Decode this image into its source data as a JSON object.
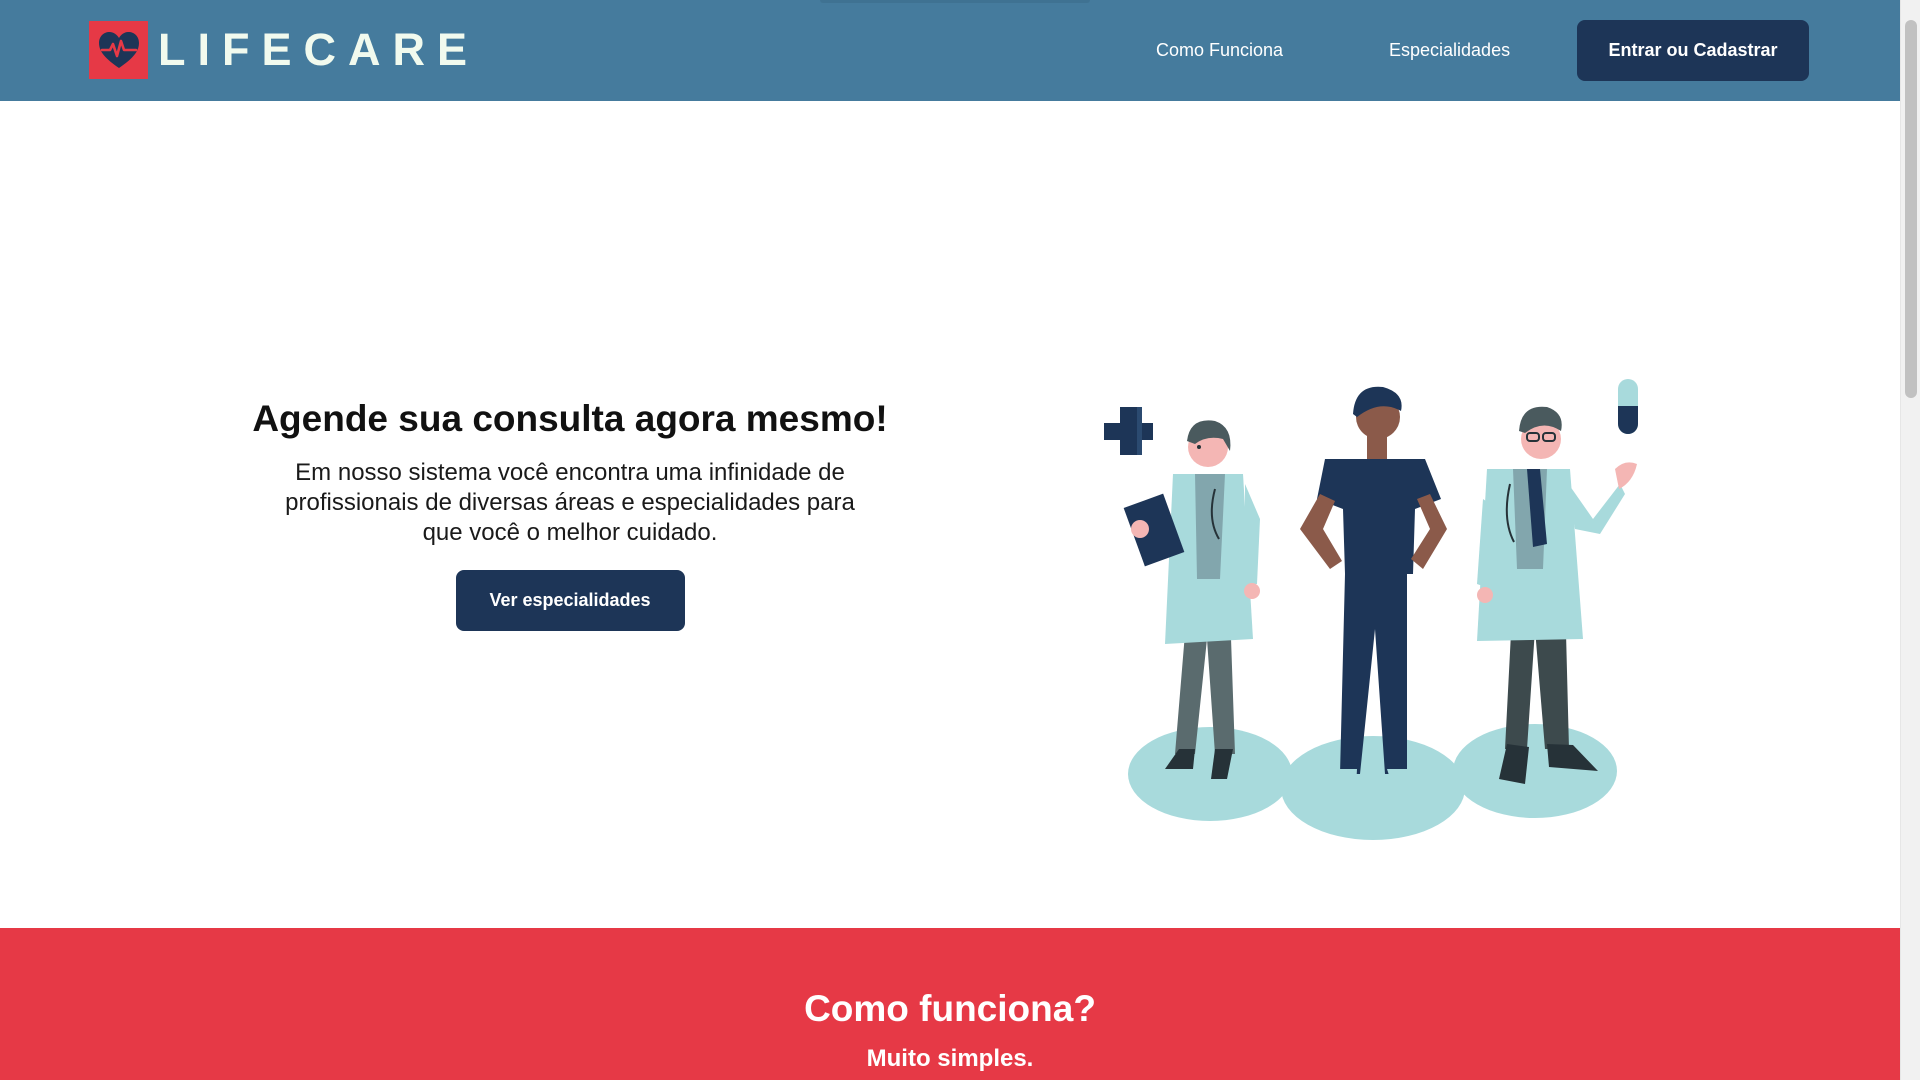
{
  "header": {
    "logo_text": "LIFECARE",
    "nav": {
      "how_it_works": "Como Funciona",
      "specialties": "Especialidades",
      "login_button": "Entrar ou Cadastrar"
    }
  },
  "hero": {
    "title": "Agende sua consulta agora mesmo!",
    "description": "Em nosso sistema você encontra uma infinidade de profissionais de diversas áreas e especialidades para que você o melhor cuidado.",
    "cta_button": "Ver especialidades"
  },
  "how_section": {
    "title": "Como funciona?",
    "subtitle": "Muito simples."
  },
  "icons": {
    "logo": "heart-pulse-icon"
  },
  "colors": {
    "header_bg": "#457b9d",
    "primary_dark": "#1d3557",
    "accent_red": "#e63946",
    "illustration_teal": "#a8dadc"
  }
}
